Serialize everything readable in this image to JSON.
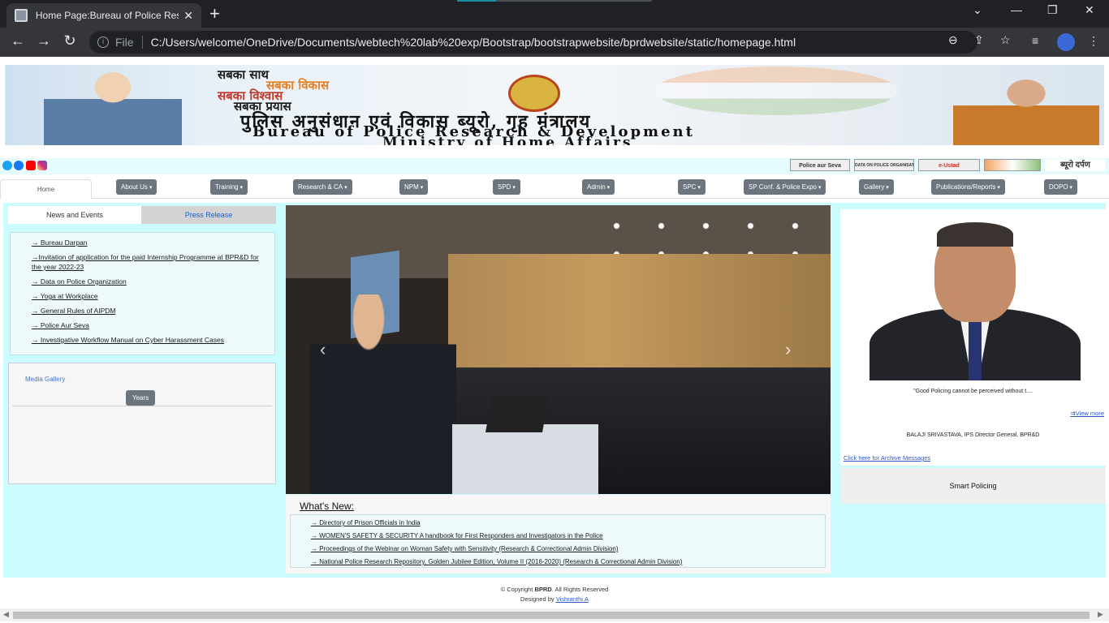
{
  "browser": {
    "tab_title": "Home Page:Bureau of Police Rese",
    "close_tab": "✕",
    "new_tab": "+",
    "scheme_label": "File",
    "url": "C:/Users/welcome/OneDrive/Documents/webtech%20lab%20exp/Bootstrap/bootstrapwebsite/bprdwebsite/static/homepage.html",
    "nav": {
      "back": "←",
      "forward": "→",
      "reload": "↻"
    },
    "window": {
      "chevron": "⌄",
      "minimize": "—",
      "restore": "❐",
      "close": "✕"
    },
    "actions": {
      "zoom": "⊖",
      "share": "⇪",
      "star": "☆",
      "media": "≡",
      "menu": "⋮"
    }
  },
  "banner": {
    "slogan": [
      "सबका साथ",
      "सबका विकास",
      "सबका विश्वास",
      "सबका प्रयास"
    ],
    "title_hindi": "पुलिस अनुसंधान एवं विकास ब्यूरो, गृह मंत्रालय",
    "title_en": "Bureau of Police Research & Development",
    "ministry": "Ministry of Home Affairs",
    "logo_text": "BPRD"
  },
  "social": [
    "twitter-icon",
    "facebook-icon",
    "youtube-icon",
    "instagram-icon"
  ],
  "partners": [
    "Police aur Seva",
    "DATA ON POLICE ORGANISATION",
    "e-Ustad",
    "",
    "ब्यूरो दर्पण"
  ],
  "nav": {
    "home": "Home",
    "items": [
      "About Us",
      "Training",
      "Research & CA",
      "NPM",
      "SPD",
      "Admin",
      "SPC",
      "SP Conf. & Police Expo",
      "Gallery",
      "Publications/Reports",
      "DOPO"
    ]
  },
  "tabs": {
    "news": "News and Events",
    "press": "Press Release"
  },
  "news": [
    "→ Bureau Darpan",
    "→Invitation of application for the paid Internship Programme at BPR&D for the year 2022-23",
    "→ Data on Police Organization",
    "→ Yoga at Workplace",
    "→ General Rules of AIPDM",
    "→ Police Aur Seva",
    "→ Investigative Workflow Manual on Cyber Harassment Cases"
  ],
  "media": {
    "label": "Media Gallery",
    "years_button": "Years"
  },
  "carousel": {
    "prev": "‹",
    "next": "›"
  },
  "whats_new": {
    "heading": "What's New:",
    "items": [
      "→ Directory of Prison Officials in India",
      "→ WOMEN'S SAFETY & SECURITY A handbook for First Responders and Investigators in the Police",
      "→ Proceedings of the Webinar on Woman Safety with Sensitivity (Research & Correctional Admin Division)",
      "→ National Police Research Repository, Golden Jubilee Edition, Volume II (2016-2020) (Research & Correctional Admin Division)"
    ]
  },
  "dg": {
    "quote": "\"Good Policing cannot be perceived without t....",
    "view_more": "⇉View more",
    "name": "BALAJI SRIVASTAVA, IPS Director General, BPR&D",
    "archive": "Click here for Archive Messages"
  },
  "smart_policing": "Smart Policing",
  "footer": {
    "copyright_prefix": "© Copyright ",
    "org": "BPRD",
    "copyright_suffix": ". All Rights Reserved",
    "designed_by": "Designed by ",
    "designer": "Vishranthi.A"
  },
  "colors": {
    "content_bg": "#ccfbfd",
    "nav_button": "#6c757d",
    "link": "#2b57c9"
  }
}
